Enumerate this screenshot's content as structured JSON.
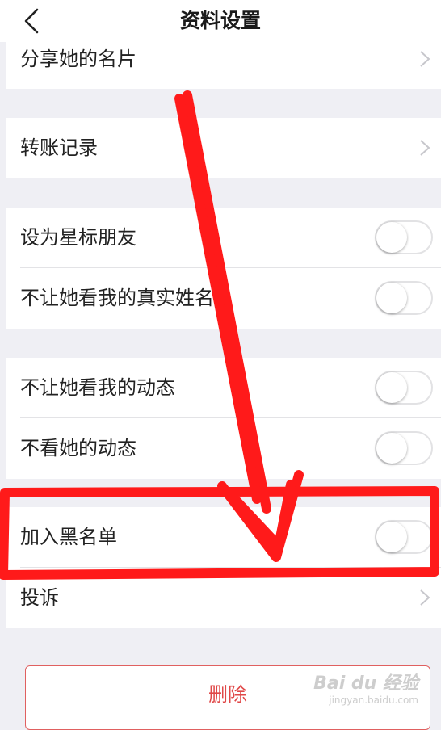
{
  "header": {
    "title": "资料设置"
  },
  "rows": {
    "share_card": "分享她的名片",
    "transfer_records": "转账记录",
    "star_friend": "设为星标朋友",
    "hide_real_name": "不让她看我的真实姓名",
    "hide_my_moments": "不让她看我的动态",
    "hide_her_moments": "不看她的动态",
    "blacklist": "加入黑名单",
    "report": "投诉"
  },
  "toggles": {
    "star_friend": "off",
    "hide_real_name": "off",
    "hide_my_moments": "off",
    "hide_her_moments": "off",
    "blacklist": "off"
  },
  "actions": {
    "delete": "删除"
  },
  "watermark": {
    "brand": "Bai du 经验",
    "url": "jingyan.baidu.com"
  },
  "colors": {
    "accent_red": "#e04848",
    "annotation_red": "#ff1a1a"
  }
}
